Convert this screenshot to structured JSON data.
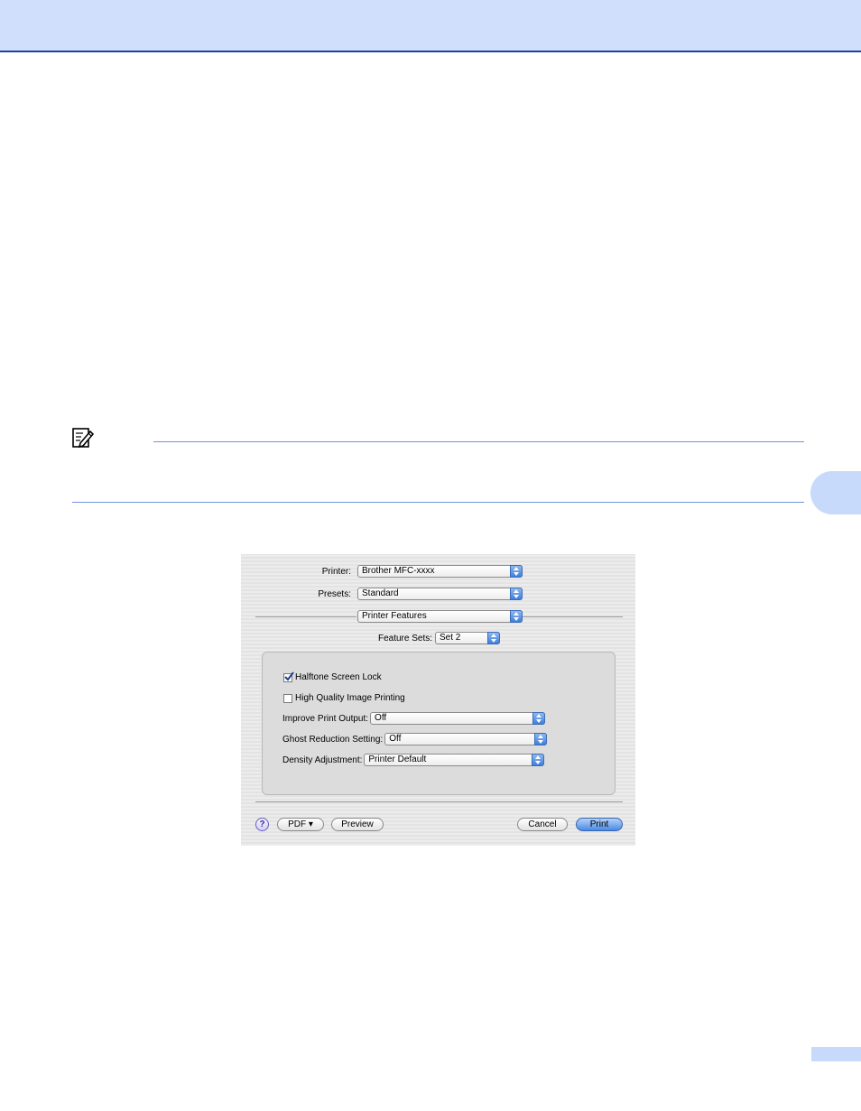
{
  "dialog": {
    "printer_label": "Printer:",
    "printer_value": "Brother MFC-xxxx",
    "presets_label": "Presets:",
    "presets_value": "Standard",
    "panel_value": "Printer Features",
    "feature_sets_label": "Feature Sets:",
    "feature_sets_value": "Set 2",
    "options": {
      "halftone_label": "Halftone Screen Lock",
      "halftone_checked": true,
      "hq_image_label": "High Quality Image Printing",
      "hq_image_checked": false,
      "improve_output_label": "Improve Print Output:",
      "improve_output_value": "Off",
      "ghost_label": "Ghost Reduction Setting:",
      "ghost_value": "Off",
      "density_label": "Density Adjustment:",
      "density_value": "Printer Default"
    },
    "buttons": {
      "help": "?",
      "pdf": "PDF ▾",
      "preview": "Preview",
      "cancel": "Cancel",
      "print": "Print"
    }
  },
  "colors": {
    "header_band": "#cfdffc",
    "header_rule": "#1f3fa8",
    "note_rule": "#6f95e0",
    "accent_tab": "#c7dafb"
  }
}
